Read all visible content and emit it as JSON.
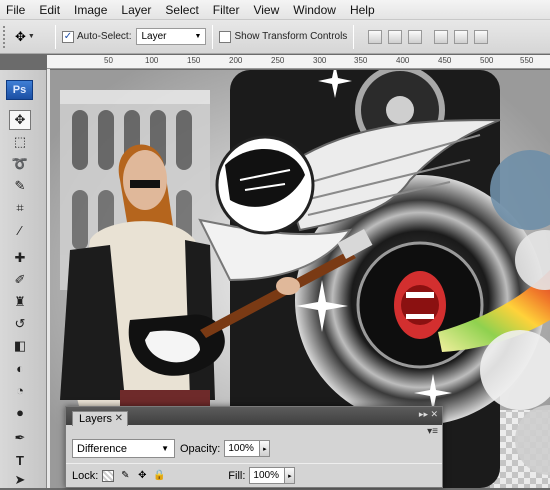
{
  "menu": [
    "File",
    "Edit",
    "Image",
    "Layer",
    "Select",
    "Filter",
    "View",
    "Window",
    "Help"
  ],
  "options": {
    "auto_select_label": "Auto-Select:",
    "auto_select_checked": true,
    "auto_select_value": "Layer",
    "show_transform_label": "Show Transform Controls",
    "show_transform_checked": false
  },
  "ruler": [
    "50",
    "100",
    "150",
    "200",
    "250",
    "300",
    "350",
    "400",
    "450",
    "500",
    "550",
    "600"
  ],
  "toolbox": {
    "logo": "Ps",
    "tools": [
      "move-tool",
      "marquee-tool",
      "lasso-tool",
      "quick-select-tool",
      "crop-tool",
      "eyedropper-tool",
      "healing-brush-tool",
      "brush-tool",
      "clone-stamp-tool",
      "history-brush-tool",
      "eraser-tool",
      "gradient-tool",
      "blur-tool",
      "dodge-tool",
      "pen-tool",
      "type-tool",
      "path-select-tool"
    ]
  },
  "layers_panel": {
    "tab": "Layers",
    "blend_mode": "Difference",
    "opacity_label": "Opacity:",
    "opacity_value": "100%",
    "lock_label": "Lock:",
    "fill_label": "Fill:",
    "fill_value": "100%"
  },
  "colors": {
    "menubar": "#e8e8e8",
    "logo": "#2a62bf",
    "layers_title": "#4a4a4a"
  }
}
